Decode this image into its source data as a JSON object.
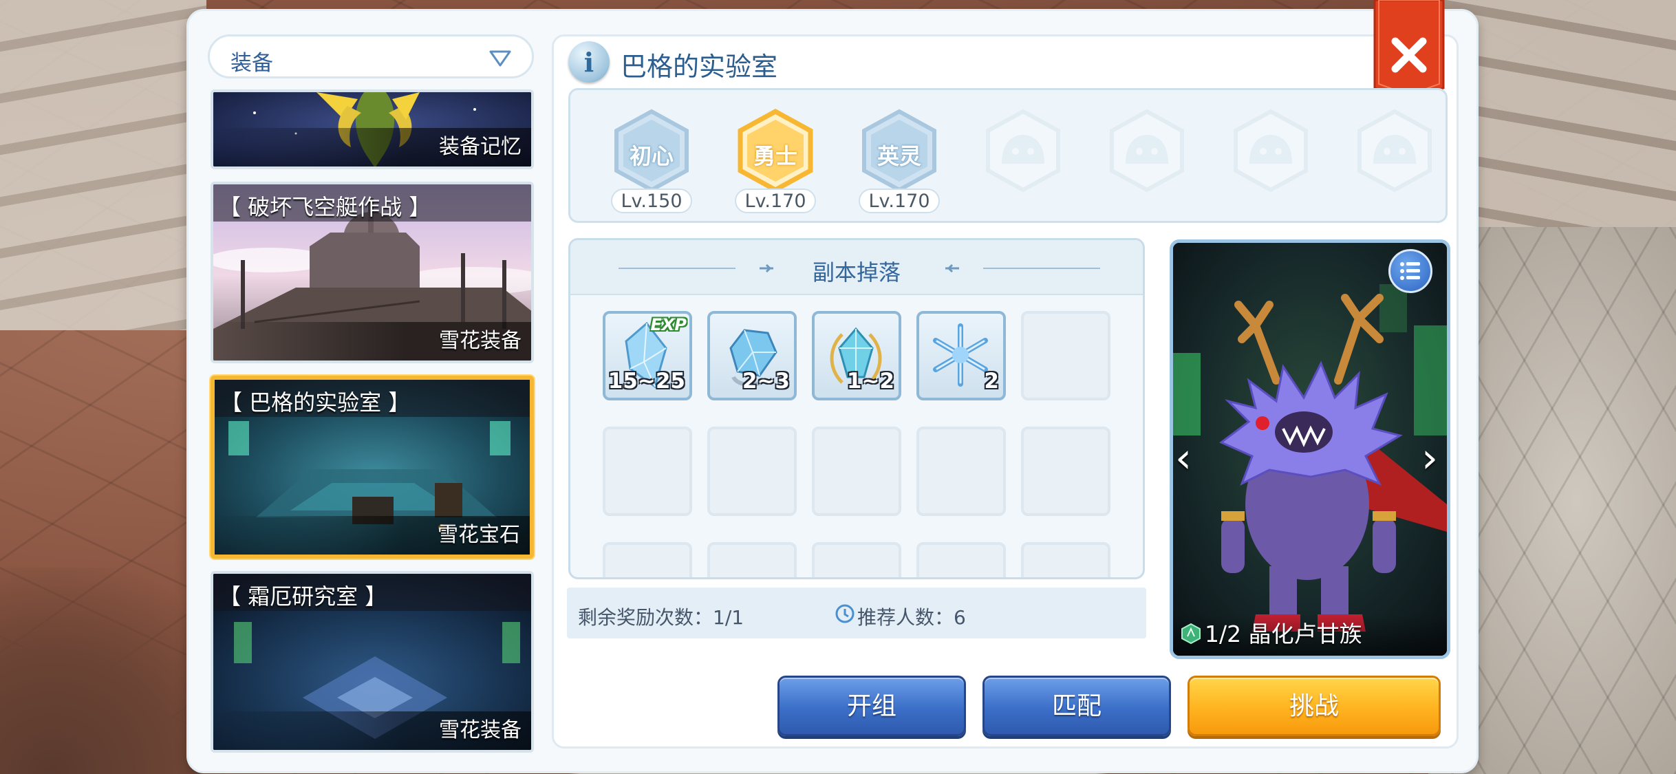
{
  "category_selector": {
    "selected": "装备"
  },
  "dungeon_list": [
    {
      "title": "",
      "tag": "装备记忆"
    },
    {
      "title": "【 破坏飞空艇作战 】",
      "tag": "雪花装备"
    },
    {
      "title": "【 巴格的实验室 】",
      "tag": "雪花宝石",
      "selected": true
    },
    {
      "title": "【 霜厄研究室 】",
      "tag": "雪花装备"
    }
  ],
  "header": {
    "info_icon_glyph": "i",
    "dungeon_name": "巴格的实验室",
    "close_glyph": "✕"
  },
  "difficulties": [
    {
      "name": "初心",
      "level": "Lv.150",
      "state": "available"
    },
    {
      "name": "勇士",
      "level": "Lv.170",
      "state": "selected"
    },
    {
      "name": "英灵",
      "level": "Lv.170",
      "state": "available"
    },
    {
      "name": "",
      "level": "",
      "state": "locked"
    },
    {
      "name": "",
      "level": "",
      "state": "locked"
    },
    {
      "name": "",
      "level": "",
      "state": "locked"
    },
    {
      "name": "",
      "level": "",
      "state": "locked"
    }
  ],
  "drops": {
    "title": "副本掉落",
    "items": [
      {
        "icon": "exp-crystal-icon",
        "badge": "EXP",
        "qty": "15~25"
      },
      {
        "icon": "blue-crystal-icon",
        "badge": "",
        "qty": "2~3"
      },
      {
        "icon": "gold-framed-crystal-icon",
        "badge": "",
        "qty": "1~2"
      },
      {
        "icon": "snowflake-icon",
        "badge": "",
        "qty": "2"
      }
    ]
  },
  "info_bar": {
    "remaining": "剩余奖励次数：1/1",
    "recommended": "推荐人数：6"
  },
  "boss": {
    "name": "1/2 晶化卢甘族",
    "list_icon": "list-icon",
    "prev_glyph": "‹",
    "next_glyph": "›"
  },
  "buttons": {
    "form_group": "开组",
    "match": "匹配",
    "challenge": "挑战"
  },
  "colors": {
    "title_blue": "#2b5d8f",
    "selected_gold": "#f7b732",
    "close_red": "#e0401e",
    "button_blue": "#3b6fc8",
    "button_gold": "#ffb31f"
  }
}
